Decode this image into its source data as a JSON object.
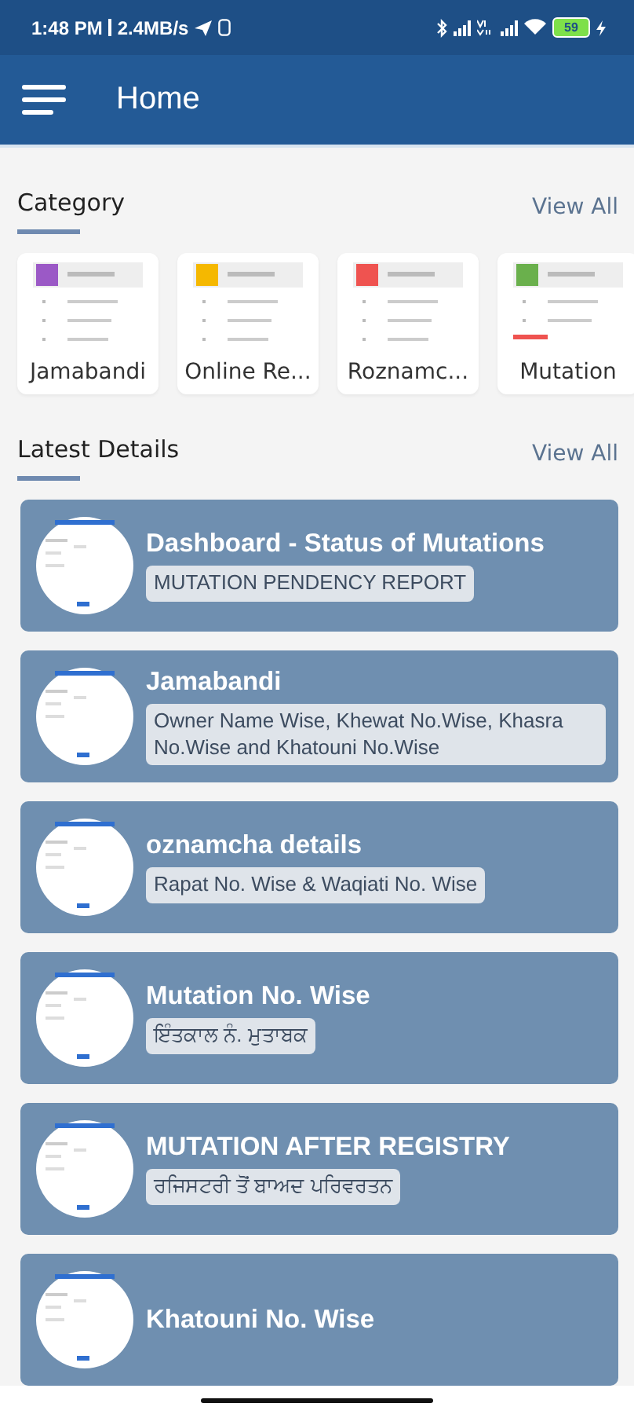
{
  "status_bar": {
    "time": "1:48 PM",
    "speed": "2.4MB/s",
    "battery": "59"
  },
  "app_bar": {
    "title": "Home"
  },
  "category": {
    "heading": "Category",
    "view_all": "View All",
    "items": [
      {
        "label": "Jamabandi",
        "color": "#9b59c6"
      },
      {
        "label": "Online Re...",
        "color": "#f5b800"
      },
      {
        "label": "Roznamc...",
        "color": "#ef5350"
      },
      {
        "label": "Mutation",
        "color": "#6ab04c"
      }
    ]
  },
  "latest": {
    "heading": "Latest Details",
    "view_all": "View All",
    "items": [
      {
        "title": "Dashboard - Status of Mutations",
        "subtitle": "MUTATION PENDENCY REPORT"
      },
      {
        "title": "Jamabandi",
        "subtitle": "Owner Name Wise, Khewat No.Wise, Khasra No.Wise and Khatouni No.Wise"
      },
      {
        "title": "oznamcha details",
        "subtitle": "Rapat No. Wise & Waqiati No. Wise"
      },
      {
        "title": "Mutation No. Wise",
        "subtitle": "ਇੰਤਕਾਲ ਨੰ. ਮੁਤਾਬਕ"
      },
      {
        "title": "MUTATION AFTER REGISTRY",
        "subtitle": "ਰਜਿਸਟਰੀ ਤੋਂ ਬਾਅਦ ਪਰਿਵਰਤਨ"
      },
      {
        "title": "Khatouni No. Wise"
      }
    ]
  }
}
